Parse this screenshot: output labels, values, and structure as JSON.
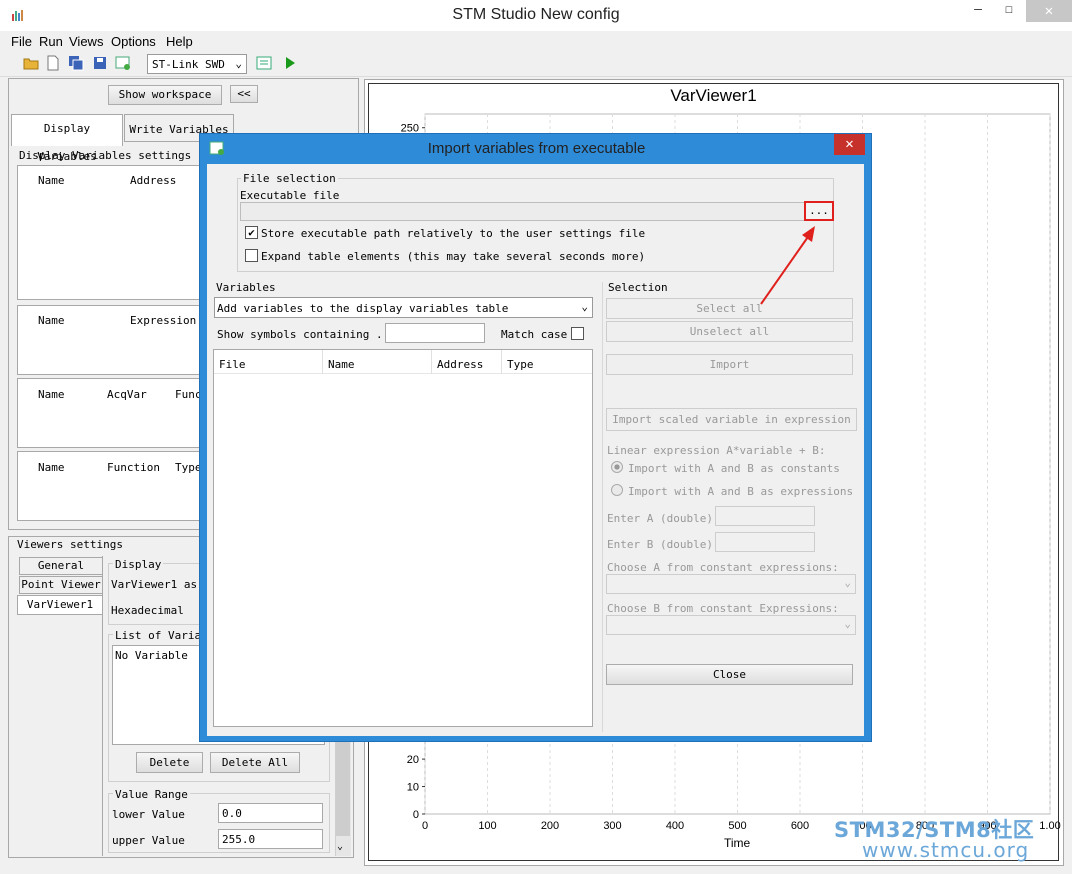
{
  "window": {
    "title": "STM Studio New config",
    "minimize": "—",
    "maximize": "☐",
    "close": "✕"
  },
  "menu": [
    "File",
    "Run",
    "Views",
    "Options",
    "Help"
  ],
  "toolbar": {
    "probe_select": "ST-Link SWD",
    "icons": [
      "open-folder-icon",
      "new-file-icon",
      "save-all-icon",
      "save-icon",
      "import-icon",
      "list-icon",
      "run-icon"
    ]
  },
  "left": {
    "show_workspace": "Show workspace",
    "collapse": "<<",
    "tabs": [
      "Display Variables",
      "Write Variables"
    ],
    "settings_label": "Display Variables settings",
    "table1_headers": [
      "Name",
      "Address"
    ],
    "table2_headers": [
      "Name",
      "Expression"
    ],
    "table3_headers": [
      "Name",
      "AcqVar",
      "Func"
    ],
    "table4_headers": [
      "Name",
      "Function",
      "Type"
    ],
    "viewers_settings": "Viewers settings",
    "viewer_tabs": [
      "General",
      "Point Viewer",
      "VarViewer1"
    ],
    "display_group": "Display",
    "display_line1": "VarViewer1 as",
    "display_line2": "Hexadecimal",
    "list_group": "List of Variab",
    "no_variable": "No Variable",
    "delete": "Delete",
    "delete_all": "Delete All",
    "value_range": "Value Range",
    "lower_label": "lower Value",
    "lower_value": "0.0",
    "upper_label": "upper Value",
    "upper_value": "255.0"
  },
  "viewer": {
    "title": "VarViewer1",
    "xlabel": "Time",
    "y_visible_ticks": [
      "250",
      "20",
      "10",
      "0"
    ],
    "x_ticks": [
      "0",
      "100",
      "200",
      "300",
      "400",
      "500",
      "600",
      "700",
      "800",
      "900",
      "1.00"
    ]
  },
  "dialog": {
    "title": "Import variables from executable",
    "close": "✕",
    "file_selection": "File selection",
    "executable_file": "Executable file",
    "executable_path": "",
    "browse": "...",
    "store_relative": "Store executable path relatively to the user settings file",
    "store_relative_checked": true,
    "expand_table": "Expand table elements (this may take several seconds more)",
    "expand_table_checked": false,
    "variables": "Variables",
    "add_to_select": "Add variables to the display variables table",
    "show_symbols": "Show symbols containing ...",
    "symbol_filter": "",
    "match_case": "Match case",
    "table_headers": [
      "File",
      "Name",
      "Address",
      "Type"
    ],
    "selection": "Selection",
    "select_all": "Select all",
    "unselect_all": "Unselect all",
    "import": "Import",
    "import_scaled": "Import scaled variable in expression",
    "linear_expr": "Linear expression A*variable + B:",
    "radio_constants": "Import with A and B as constants",
    "radio_expressions": "Import with A and B as expressions",
    "enter_a": "Enter A (double):",
    "enter_b": "Enter B (double):",
    "choose_a": "Choose A from constant expressions:",
    "choose_b": "Choose B from constant Expressions:",
    "close_button": "Close"
  },
  "watermark": {
    "line1": "STM32/STM8社区",
    "line2": "www.stmcu.org"
  },
  "colors": {
    "dialog_frame": "#2e8bd8",
    "close_red": "#c7312b",
    "annotation_red": "#e0201c",
    "watermark": "#6ba7d8"
  }
}
